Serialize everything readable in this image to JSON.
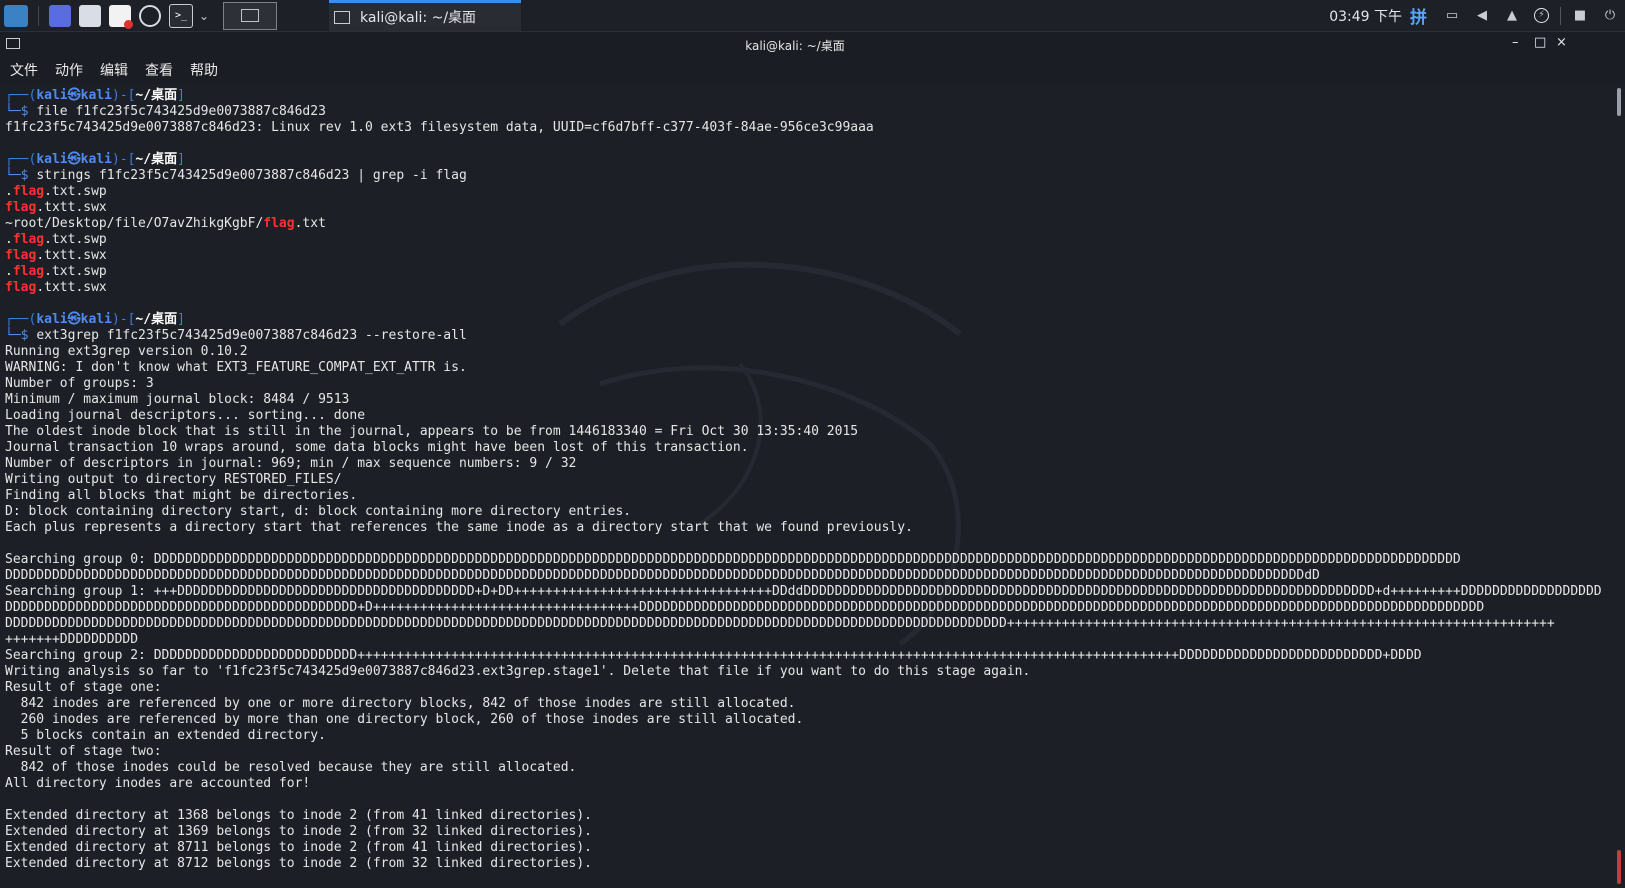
{
  "panel": {
    "launchers": [
      {
        "name": "show-desktop-icon"
      },
      {
        "name": "file-manager-icon"
      },
      {
        "name": "text-editor-icon"
      },
      {
        "name": "web-browser-icon"
      },
      {
        "name": "terminal-icon"
      }
    ],
    "task_title": "kali@kali: ~/桌面",
    "clock": "03:49 下午",
    "ime": "拼"
  },
  "window": {
    "title": "kali@kali: ~/桌面",
    "minimize": "–",
    "maximize": "□",
    "close": "×"
  },
  "menu": [
    "文件",
    "动作",
    "编辑",
    "查看",
    "帮助"
  ],
  "prompt": {
    "line1_left": "┌──(",
    "host": "kali㉿kali",
    "mid": ")-[",
    "dir": "~/桌面",
    "right": "]",
    "line2": "└─$ "
  },
  "terminal": {
    "lines": [
      {
        "kind": "prompt"
      },
      {
        "kind": "cmd",
        "text": "file f1fc23f5c743425d9e0073887c846d23"
      },
      {
        "kind": "out",
        "text": "f1fc23f5c743425d9e0073887c846d23: Linux rev 1.0 ext3 filesystem data, UUID=cf6d7bff-c377-403f-84ae-956ce3c99aaa"
      },
      {
        "kind": "out",
        "text": ""
      },
      {
        "kind": "prompt"
      },
      {
        "kind": "cmd",
        "text": "strings f1fc23f5c743425d9e0073887c846d23 | grep -i flag"
      },
      {
        "kind": "hl",
        "parts": [
          ".",
          "flag",
          ".txt.swp"
        ]
      },
      {
        "kind": "hl",
        "parts": [
          "",
          "flag",
          ".txtt.swx"
        ]
      },
      {
        "kind": "hl",
        "parts": [
          "~root/Desktop/file/O7avZhikgKgbF/",
          "flag",
          ".txt"
        ]
      },
      {
        "kind": "hl",
        "parts": [
          ".",
          "flag",
          ".txt.swp"
        ]
      },
      {
        "kind": "hl",
        "parts": [
          "",
          "flag",
          ".txtt.swx"
        ]
      },
      {
        "kind": "hl",
        "parts": [
          ".",
          "flag",
          ".txt.swp"
        ]
      },
      {
        "kind": "hl",
        "parts": [
          "",
          "flag",
          ".txtt.swx"
        ]
      },
      {
        "kind": "out",
        "text": ""
      },
      {
        "kind": "prompt"
      },
      {
        "kind": "cmd",
        "text": "ext3grep f1fc23f5c743425d9e0073887c846d23 --restore-all"
      },
      {
        "kind": "out",
        "text": "Running ext3grep version 0.10.2"
      },
      {
        "kind": "out",
        "text": "WARNING: I don't know what EXT3_FEATURE_COMPAT_EXT_ATTR is."
      },
      {
        "kind": "out",
        "text": "Number of groups: 3"
      },
      {
        "kind": "out",
        "text": "Minimum / maximum journal block: 8484 / 9513"
      },
      {
        "kind": "out",
        "text": "Loading journal descriptors... sorting... done"
      },
      {
        "kind": "out",
        "text": "The oldest inode block that is still in the journal, appears to be from 1446183340 = Fri Oct 30 13:35:40 2015"
      },
      {
        "kind": "out",
        "text": "Journal transaction 10 wraps around, some data blocks might have been lost of this transaction."
      },
      {
        "kind": "out",
        "text": "Number of descriptors in journal: 969; min / max sequence numbers: 9 / 32"
      },
      {
        "kind": "out",
        "text": "Writing output to directory RESTORED_FILES/"
      },
      {
        "kind": "out",
        "text": "Finding all blocks that might be directories."
      },
      {
        "kind": "out",
        "text": "D: block containing directory start, d: block containing more directory entries."
      },
      {
        "kind": "out",
        "text": "Each plus represents a directory start that references the same inode as a directory start that we found previously."
      },
      {
        "kind": "out",
        "text": ""
      },
      {
        "kind": "out",
        "text": "Searching group 0: DDDDDDDDDDDDDDDDDDDDDDDDDDDDDDDDDDDDDDDDDDDDDDDDDDDDDDDDDDDDDDDDDDDDDDDDDDDDDDDDDDDDDDDDDDDDDDDDDDDDDDDDDDDDDDDDDDDDDDDDDDDDDDDDDDDDDDDDDDDDDDDDDDDDDDDDDDDDDDDDDDDDDDD"
      },
      {
        "kind": "out",
        "text": "DDDDDDDDDDDDDDDDDDDDDDDDDDDDDDDDDDDDDDDDDDDDDDDDDDDDDDDDDDDDDDDDDDDDDDDDDDDDDDDDDDDDDDDDDDDDDDDDDDDDDDDDDDDDDDDDDDDDDDDDDDDDDDDDDDDDDDDDDDDDDDDDDDDDDDDDDDDDDDDDDDDDDDdD"
      },
      {
        "kind": "out",
        "text": "Searching group 1: +++DDDDDDDDDDDDDDDDDDDDDDDDDDDDDDDDDDDDDD+D+DD+++++++++++++++++++++++++++++++++DDddDDDDDDDDDDDDDDDDDDDDDDDDDDDDDDDDDDDDDDDDDDDDDDDDDDDDDDDDDDDDDDDDDDDDDDDDD+d+++++++++DDDDDDDDDDDDDDDDDD"
      },
      {
        "kind": "out",
        "text": "DDDDDDDDDDDDDDDDDDDDDDDDDDDDDDDDDDDDDDDDDDDDD+D++++++++++++++++++++++++++++++++++DDDDDDDDDDDDDDDDDDDDDDDDDDDDDDDDDDDDDDDDDDDDDDDDDDDDDDDDDDDDDDDDDDDDDDDDDDDDDDDDDDDDDDDDDDDDDDDDDDDDDDDDDDDD"
      },
      {
        "kind": "out",
        "text": "DDDDDDDDDDDDDDDDDDDDDDDDDDDDDDDDDDDDDDDDDDDDDDDDDDDDDDDDDDDDDDDDDDDDDDDDDDDDDDDDDDDDDDDDDDDDDDDDDDDDDDDDDDDDDDDDDDDDDDDDDDDDDDDD++++++++++++++++++++++++++++++++++++++++++++++++++++++++++++++++++++++"
      },
      {
        "kind": "out",
        "text": "+++++++DDDDDDDDDD"
      },
      {
        "kind": "out",
        "text": "Searching group 2: DDDDDDDDDDDDDDDDDDDDDDDDDD+++++++++++++++++++++++++++++++++++++++++++++++++++++++++++++++++++++++++++++++++++++++++++++++++++++++++DDDDDDDDDDDDDDDDDDDDDDDDDD+DDDD"
      },
      {
        "kind": "out",
        "text": "Writing analysis so far to 'f1fc23f5c743425d9e0073887c846d23.ext3grep.stage1'. Delete that file if you want to do this stage again."
      },
      {
        "kind": "out",
        "text": "Result of stage one:"
      },
      {
        "kind": "out",
        "text": "  842 inodes are referenced by one or more directory blocks, 842 of those inodes are still allocated."
      },
      {
        "kind": "out",
        "text": "  260 inodes are referenced by more than one directory block, 260 of those inodes are still allocated."
      },
      {
        "kind": "out",
        "text": "  5 blocks contain an extended directory."
      },
      {
        "kind": "out",
        "text": "Result of stage two:"
      },
      {
        "kind": "out",
        "text": "  842 of those inodes could be resolved because they are still allocated."
      },
      {
        "kind": "out",
        "text": "All directory inodes are accounted for!"
      },
      {
        "kind": "out",
        "text": ""
      },
      {
        "kind": "out",
        "text": "Extended directory at 1368 belongs to inode 2 (from 41 linked directories)."
      },
      {
        "kind": "out",
        "text": "Extended directory at 1369 belongs to inode 2 (from 32 linked directories)."
      },
      {
        "kind": "out",
        "text": "Extended directory at 8711 belongs to inode 2 (from 41 linked directories)."
      },
      {
        "kind": "out",
        "text": "Extended directory at 8712 belongs to inode 2 (from 32 linked directories)."
      }
    ]
  },
  "colors": {
    "prompt_box": "#3b7dd8",
    "prompt_host": "#4f8bf0",
    "highlight": "#ff3030",
    "text": "#e6e6e6",
    "background": "#1c1f26"
  }
}
